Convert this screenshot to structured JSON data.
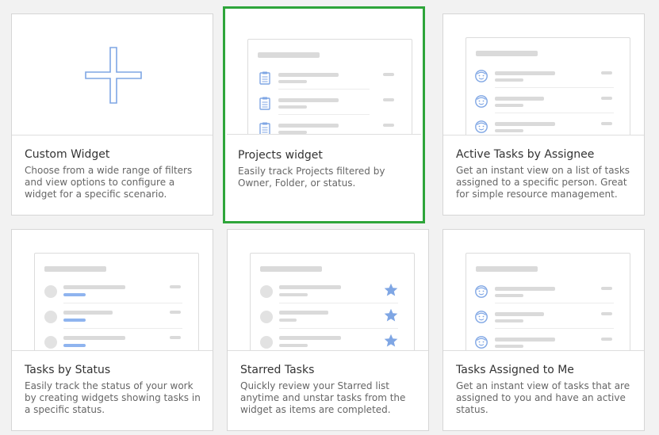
{
  "colors": {
    "selected_border": "#2ea53a",
    "accent_blue": "#8fb4ef",
    "placeholder_gray": "#dadada"
  },
  "widgets": [
    {
      "title": "Custom Widget",
      "description": "Choose from a wide range of filters and view options to configure a widget for a specific scenario.",
      "preview": "plus-icon"
    },
    {
      "title": "Projects widget",
      "description": "Easily track Projects filtered by Owner, Folder, or status.",
      "preview": "clipboard-icon",
      "selected": true
    },
    {
      "title": "Active Tasks by Assignee",
      "description": "Get an instant view on a list of tasks assigned to a specific person. Great for simple resource management.",
      "preview": "smiley-icon"
    },
    {
      "title": "Tasks by Status",
      "description": "Easily track the status of your work by creating widgets showing tasks in a specific status.",
      "preview": "status-circle"
    },
    {
      "title": "Starred Tasks",
      "description": "Quickly review your Starred list anytime and unstar tasks from the widget as items are completed.",
      "preview": "star-icon"
    },
    {
      "title": "Tasks Assigned to Me",
      "description": "Get an instant view of tasks that are assigned to you and have an active status.",
      "preview": "smiley-icon"
    }
  ]
}
